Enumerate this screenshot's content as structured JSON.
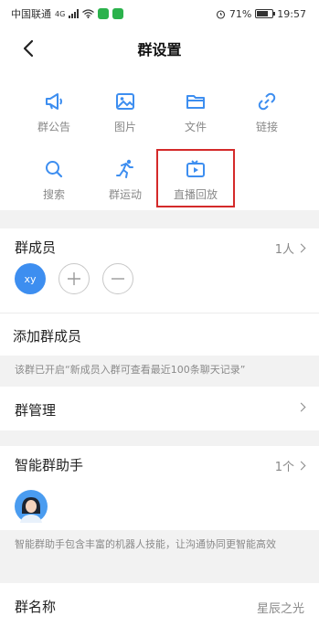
{
  "status_bar": {
    "carrier": "中国联通",
    "network": "4G",
    "battery": "71%",
    "time": "19:57"
  },
  "header": {
    "title": "群设置"
  },
  "tools": [
    {
      "label": "群公告",
      "icon": "megaphone-icon"
    },
    {
      "label": "图片",
      "icon": "image-icon"
    },
    {
      "label": "文件",
      "icon": "folder-icon"
    },
    {
      "label": "链接",
      "icon": "link-icon"
    },
    {
      "label": "搜索",
      "icon": "search-icon"
    },
    {
      "label": "群运动",
      "icon": "running-icon"
    },
    {
      "label": "直播回放",
      "icon": "tv-icon"
    }
  ],
  "members": {
    "title": "群成员",
    "count": "1人",
    "avatar_text": "xy"
  },
  "add_member": {
    "label": "添加群成员"
  },
  "history_note": "该群已开启“新成员入群可查看最近100条聊天记录”",
  "manage": {
    "label": "群管理"
  },
  "assistant": {
    "title": "智能群助手",
    "count": "1个",
    "note": "智能群助手包含丰富的机器人技能，让沟通协同更智能高效"
  },
  "group_name": {
    "label": "群名称",
    "value": "星辰之光"
  },
  "colors": {
    "accent": "#3d8ef0",
    "highlight": "#d42a2a"
  }
}
